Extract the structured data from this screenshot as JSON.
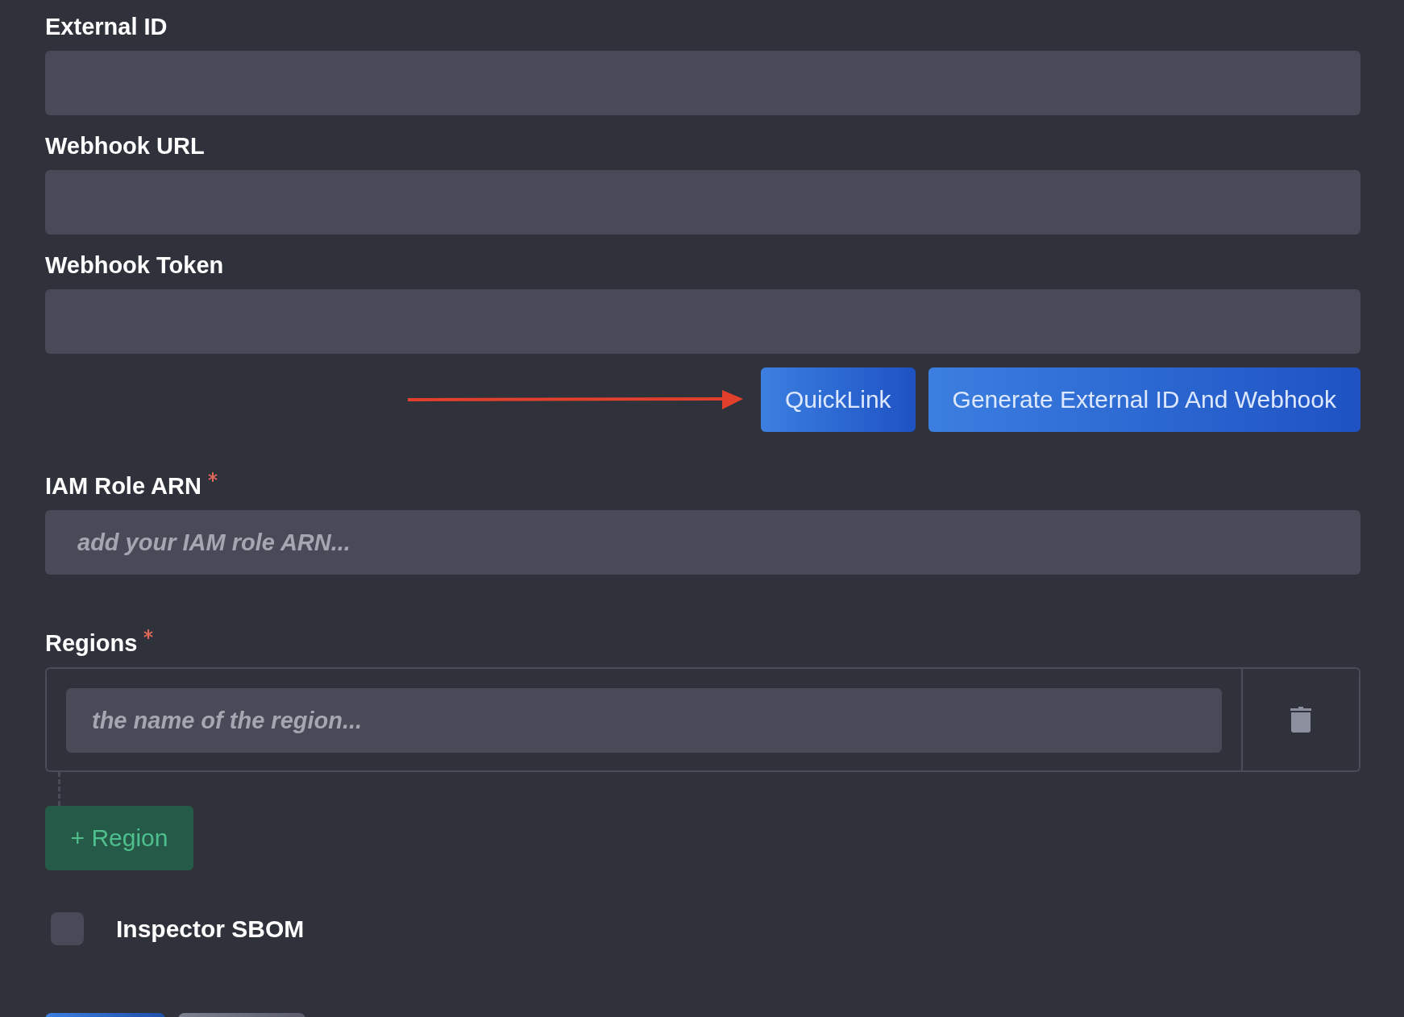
{
  "fields": [
    {
      "label": "External ID"
    },
    {
      "label": "Webhook URL"
    },
    {
      "label": "Webhook Token"
    }
  ],
  "actions": [
    {
      "label": "QuickLink"
    },
    {
      "label": "Generate External ID And Webhook"
    }
  ],
  "annotation": {
    "kind": "arrow"
  },
  "iam_role": {
    "label": "IAM Role ARN",
    "required": true,
    "placeholder": "add your IAM role ARN..."
  },
  "regions": {
    "label": "Regions",
    "required": true,
    "items": [
      {
        "placeholder": "the name of the region..."
      }
    ],
    "add_button": "+ Region"
  },
  "inspector_sbom": {
    "label": "Inspector SBOM",
    "checked": false
  },
  "footer_buttons": [
    {
      "kind": "primary"
    },
    {
      "kind": "secondary"
    }
  ]
}
